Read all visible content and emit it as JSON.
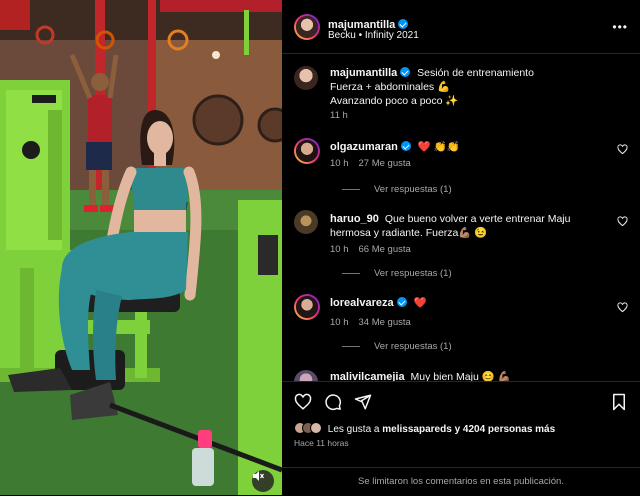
{
  "post": {
    "author": "majumantilla",
    "music_line": "Becku • Infinity 2021",
    "caption_lines": [
      "Sesión de entrenamiento",
      "Fuerza + abdominales 💪",
      "Avanzando poco a poco ✨"
    ],
    "caption_time": "11 h"
  },
  "comments": [
    {
      "user": "olgazumaran",
      "verified": true,
      "text": "❤️ 👏👏",
      "time": "10 h",
      "likes": "27 Me gusta",
      "replies": "Ver respuestas (1)"
    },
    {
      "user": "haruo_90",
      "verified": false,
      "text": "Que bueno volver a verte entrenar Maju hermosa y radiante. Fuerza💪🏽 😉",
      "time": "10 h",
      "likes": "66 Me gusta",
      "replies": "Ver respuestas (1)"
    },
    {
      "user": "lorealvareza",
      "verified": true,
      "text": "❤️",
      "time": "10 h",
      "likes": "34 Me gusta",
      "replies": "Ver respuestas (1)"
    },
    {
      "user": "malivilcamejia",
      "verified": false,
      "text": "Muy bien Maju 😊 💪🏽"
    }
  ],
  "likes": {
    "prefix": "Les gusta a",
    "user": "melissapareds",
    "suffix": "y 4204 personas más"
  },
  "time_ago": "Hace 11 horas",
  "limited_notice": "Se limitaron los comentarios en esta publicación.",
  "icons": [
    "heart-icon",
    "comment-icon",
    "share-icon",
    "bookmark-icon",
    "more-icon",
    "mute-icon",
    "verified-icon"
  ],
  "colors": {
    "verified": "#0095f6",
    "heart_red": "#ff3040",
    "secondary_text": "#a8a8a8",
    "divider": "#262626"
  }
}
